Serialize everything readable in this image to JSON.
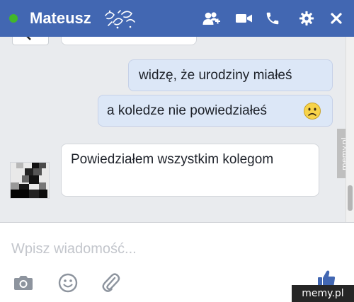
{
  "header": {
    "contact_name": "Mateusz",
    "status": "online",
    "icons": [
      "add-friends-icon",
      "video-call-icon",
      "voice-call-icon",
      "settings-icon",
      "close-icon"
    ]
  },
  "messages": [
    {
      "direction": "outgoing",
      "text": "widzę, że urodziny miałeś"
    },
    {
      "direction": "outgoing",
      "text": "a koledze nie powiedziałeś",
      "emoji": "frown-emoji-icon"
    },
    {
      "direction": "incoming",
      "text": "Powiedziałem wszystkim kolegom"
    }
  ],
  "composer": {
    "placeholder": "Wpisz wiadomość...",
    "tools": [
      "camera-icon",
      "emoji-icon",
      "attachment-icon"
    ],
    "send": "like-icon"
  },
  "watermark": {
    "text": "memy.pl"
  },
  "colors": {
    "header_bg": "#4267b2",
    "online_dot": "#42b72a",
    "outgoing_bubble": "#dce7f7",
    "incoming_bubble": "#ffffff",
    "like": "#4267b2"
  }
}
